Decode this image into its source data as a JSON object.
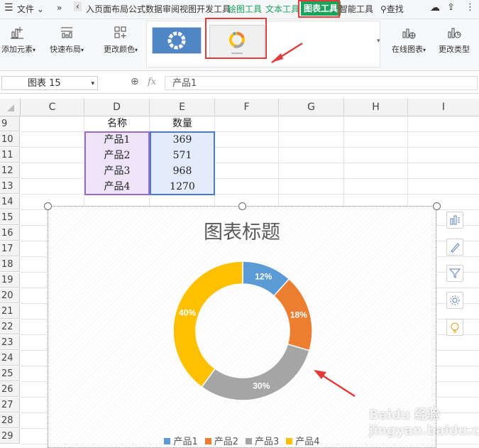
{
  "menu": {
    "file_label": "文件",
    "more_label": "»",
    "tabs_text": "入页面布局公式数据审阅视图开发工具",
    "drawing_tools": "绘图工具",
    "text_tools": "文本工具",
    "chart_tools": "图表工具",
    "smart_tools": "智能工具",
    "search_label": "查找"
  },
  "ribbon": {
    "add_element": "添加元素",
    "quick_layout": "快速布局",
    "change_color": "更改颜色",
    "online_chart": "在线图表",
    "change_type": "更改类型"
  },
  "formula_bar": {
    "name_box": "图表 15",
    "fx": "fx",
    "content": "产品1"
  },
  "columns": [
    "C",
    "D",
    "E",
    "F",
    "G",
    "H",
    "I"
  ],
  "rows": [
    "9",
    "10",
    "11",
    "12",
    "13",
    "14",
    "15",
    "16",
    "17",
    "18",
    "19",
    "20",
    "21",
    "22",
    "23",
    "24",
    "25",
    "26",
    "27",
    "28",
    "29"
  ],
  "table": {
    "header": [
      "名称",
      "数量"
    ],
    "rows": [
      [
        "产品1",
        "369"
      ],
      [
        "产品2",
        "571"
      ],
      [
        "产品3",
        "968"
      ],
      [
        "产品4",
        "1270"
      ]
    ]
  },
  "chart_data": {
    "type": "pie",
    "variant": "doughnut",
    "title": "图表标题",
    "categories": [
      "产品1",
      "产品2",
      "产品3",
      "产品4"
    ],
    "values": [
      369,
      571,
      968,
      1270
    ],
    "data_labels": [
      "12%",
      "18%",
      "30%",
      "40%"
    ],
    "colors": [
      "#5b9bd5",
      "#ed7d31",
      "#a5a5a5",
      "#ffc000"
    ],
    "legend_position": "bottom"
  },
  "colors": {
    "accent_green": "#1aa35b",
    "highlight_red": "#e23b3b"
  },
  "watermark": "Baidu 经验 jingyan.baidu.com"
}
